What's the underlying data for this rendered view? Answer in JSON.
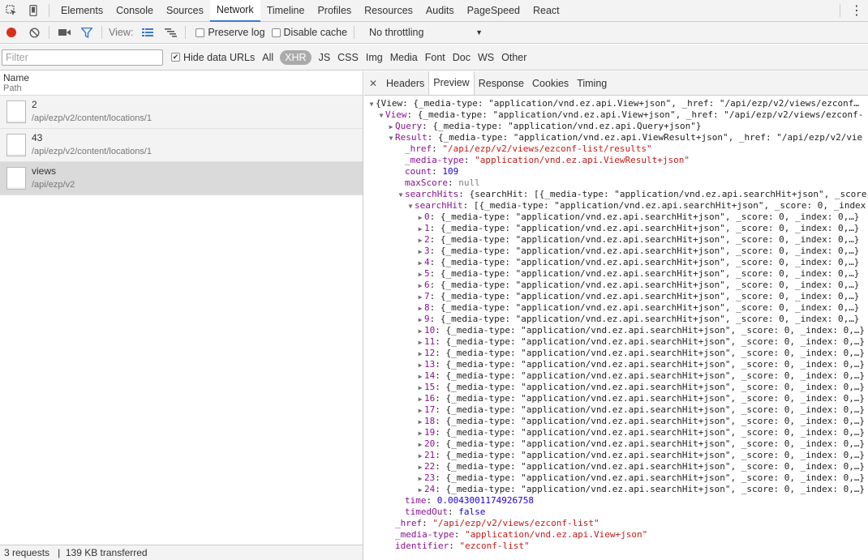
{
  "top_tabs": [
    "Elements",
    "Console",
    "Sources",
    "Network",
    "Timeline",
    "Profiles",
    "Resources",
    "Audits",
    "PageSpeed",
    "React"
  ],
  "active_top_tab": "Network",
  "toolbar": {
    "view_label": "View:",
    "preserve_log": "Preserve log",
    "disable_cache": "Disable cache",
    "throttling": "No throttling"
  },
  "filter": {
    "placeholder": "Filter",
    "hide_data_urls": "Hide data URLs",
    "types": [
      "All",
      "XHR",
      "JS",
      "CSS",
      "Img",
      "Media",
      "Font",
      "Doc",
      "WS",
      "Other"
    ],
    "active_type": "XHR"
  },
  "requests_header": {
    "name": "Name",
    "path": "Path"
  },
  "requests": [
    {
      "name": "2",
      "path": "/api/ezp/v2/content/locations/1"
    },
    {
      "name": "43",
      "path": "/api/ezp/v2/content/locations/1"
    },
    {
      "name": "views",
      "path": "/api/ezp/v2"
    }
  ],
  "status_bar": {
    "requests": "3 requests",
    "sep": "|",
    "transferred": "139 KB transferred"
  },
  "detail_tabs": [
    "Headers",
    "Preview",
    "Response",
    "Cookies",
    "Timing"
  ],
  "active_detail_tab": "Preview",
  "preview": {
    "root": "{View: {_media-type: \"application/vnd.ez.api.View+json\", _href: \"/api/ezp/v2/views/ezconf…",
    "view_key": "View",
    "view_summary": "{_media-type: \"application/vnd.ez.api.View+json\", _href: \"/api/ezp/v2/views/ezconf-",
    "query_key": "Query",
    "query_summary": "{_media-type: \"application/vnd.ez.api.Query+json\"}",
    "result_key": "Result",
    "result_summary": "{_media-type: \"application/vnd.ez.api.ViewResult+json\", _href: \"/api/ezp/v2/vie",
    "result_fields": [
      {
        "key": "_href",
        "value": "\"/api/ezp/v2/views/ezconf-list/results\"",
        "kind": "str"
      },
      {
        "key": "_media-type",
        "value": "\"application/vnd.ez.api.ViewResult+json\"",
        "kind": "str"
      },
      {
        "key": "count",
        "value": "109",
        "kind": "num"
      },
      {
        "key": "maxScore",
        "value": "null",
        "kind": "nul"
      }
    ],
    "searchhits_key": "searchHits",
    "searchhits_summary": "{searchHit: [{_media-type: \"application/vnd.ez.api.searchHit+json\", _score",
    "searchhit_key": "searchHit",
    "searchhit_summary": "[{_media-type: \"application/vnd.ez.api.searchHit+json\", _score: 0, _index",
    "hit_summary": "{_media-type: \"application/vnd.ez.api.searchHit+json\", _score: 0, _index: 0,…}",
    "hit_count": 25,
    "after_hits": [
      {
        "key": "time",
        "value": "0.0043001174926758",
        "kind": "num",
        "level": "result"
      },
      {
        "key": "timedOut",
        "value": "false",
        "kind": "num",
        "level": "result"
      },
      {
        "key": "_href",
        "value": "\"/api/ezp/v2/views/ezconf-list\"",
        "kind": "str",
        "level": "view"
      },
      {
        "key": "_media-type",
        "value": "\"application/vnd.ez.api.View+json\"",
        "kind": "str",
        "level": "view"
      },
      {
        "key": "identifier",
        "value": "\"ezconf-list\"",
        "kind": "str",
        "level": "view"
      }
    ]
  },
  "colors": {
    "record": "#d9301c",
    "accent": "#3879d9",
    "json_key": "#881391",
    "json_string": "#c41a16",
    "json_number": "#1c00cf"
  }
}
